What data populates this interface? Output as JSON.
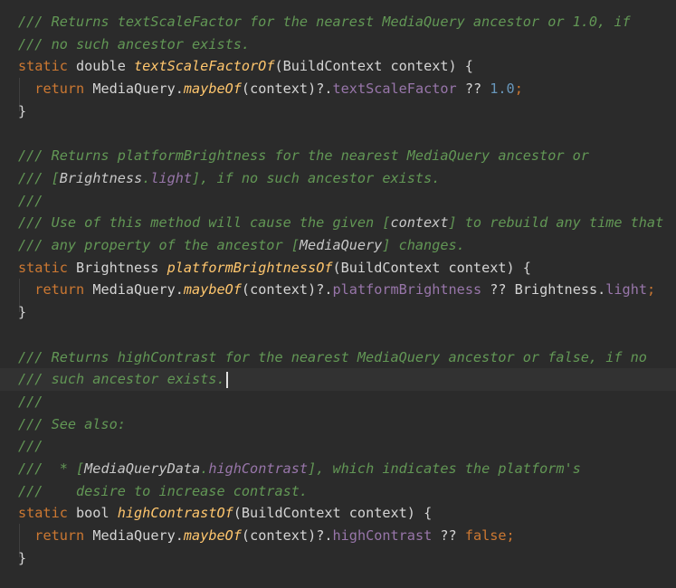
{
  "editor": {
    "language": "Dart",
    "colors": {
      "background": "#2b2b2b",
      "current_line": "#323232",
      "comment": "#629755",
      "keyword": "#cc7832",
      "function": "#ffc66d",
      "field": "#9876aa",
      "number": "#6897bb",
      "text": "#d4d4d4"
    },
    "lines": [
      [
        {
          "t": "comment",
          "v": "/// Returns textScaleFactor for the nearest MediaQuery ancestor or 1.0, if"
        }
      ],
      [
        {
          "t": "comment",
          "v": "/// no such ancestor exists."
        }
      ],
      [
        {
          "t": "keyword",
          "v": "static"
        },
        {
          "t": "plain",
          "v": " double "
        },
        {
          "t": "fn-decl",
          "v": "textScaleFactorOf"
        },
        {
          "t": "plain",
          "v": "(BuildContext context) {"
        }
      ],
      [
        {
          "t": "plain",
          "v": "  "
        },
        {
          "t": "keyword",
          "v": "return"
        },
        {
          "t": "plain",
          "v": " MediaQuery."
        },
        {
          "t": "fn-call",
          "v": "maybeOf"
        },
        {
          "t": "plain",
          "v": "(context)?."
        },
        {
          "t": "field",
          "v": "textScaleFactor"
        },
        {
          "t": "plain",
          "v": " ?? "
        },
        {
          "t": "number",
          "v": "1.0"
        },
        {
          "t": "keyword",
          "v": ";"
        }
      ],
      [
        {
          "t": "plain",
          "v": "}"
        }
      ],
      [],
      [
        {
          "t": "comment",
          "v": "/// Returns platformBrightness for the nearest MediaQuery ancestor or"
        }
      ],
      [
        {
          "t": "comment",
          "v": "/// ["
        },
        {
          "t": "doc-ref-text",
          "v": "Brightness"
        },
        {
          "t": "comment",
          "v": "."
        },
        {
          "t": "doc-ref-field",
          "v": "light"
        },
        {
          "t": "comment",
          "v": "], if no such ancestor exists."
        }
      ],
      [
        {
          "t": "comment",
          "v": "///"
        }
      ],
      [
        {
          "t": "comment",
          "v": "/// Use of this method will cause the given ["
        },
        {
          "t": "doc-ref-text",
          "v": "context"
        },
        {
          "t": "comment",
          "v": "] to rebuild any time that"
        }
      ],
      [
        {
          "t": "comment",
          "v": "/// any property of the ancestor ["
        },
        {
          "t": "doc-ref-text",
          "v": "MediaQuery"
        },
        {
          "t": "comment",
          "v": "] changes."
        }
      ],
      [
        {
          "t": "keyword",
          "v": "static"
        },
        {
          "t": "plain",
          "v": " Brightness "
        },
        {
          "t": "fn-decl",
          "v": "platformBrightnessOf"
        },
        {
          "t": "plain",
          "v": "(BuildContext context) {"
        }
      ],
      [
        {
          "t": "plain",
          "v": "  "
        },
        {
          "t": "keyword",
          "v": "return"
        },
        {
          "t": "plain",
          "v": " MediaQuery."
        },
        {
          "t": "fn-call",
          "v": "maybeOf"
        },
        {
          "t": "plain",
          "v": "(context)?."
        },
        {
          "t": "field",
          "v": "platformBrightness"
        },
        {
          "t": "plain",
          "v": " ?? Brightness."
        },
        {
          "t": "const",
          "v": "light"
        },
        {
          "t": "keyword",
          "v": ";"
        }
      ],
      [
        {
          "t": "plain",
          "v": "}"
        }
      ],
      [],
      [
        {
          "t": "comment",
          "v": "/// Returns highContrast for the nearest MediaQuery ancestor or false, if no"
        }
      ],
      [
        {
          "t": "comment",
          "v": "/// such ancestor exists."
        }
      ],
      [
        {
          "t": "comment",
          "v": "///"
        }
      ],
      [
        {
          "t": "comment",
          "v": "/// See also:"
        }
      ],
      [
        {
          "t": "comment",
          "v": "///"
        }
      ],
      [
        {
          "t": "comment",
          "v": "///  * ["
        },
        {
          "t": "doc-ref-text",
          "v": "MediaQueryData"
        },
        {
          "t": "comment",
          "v": "."
        },
        {
          "t": "doc-ref-field",
          "v": "highContrast"
        },
        {
          "t": "comment",
          "v": "], which indicates the platform's"
        }
      ],
      [
        {
          "t": "comment",
          "v": "///    desire to increase contrast."
        }
      ],
      [
        {
          "t": "keyword",
          "v": "static"
        },
        {
          "t": "plain",
          "v": " bool "
        },
        {
          "t": "fn-decl",
          "v": "highContrastOf"
        },
        {
          "t": "plain",
          "v": "(BuildContext context) {"
        }
      ],
      [
        {
          "t": "plain",
          "v": "  "
        },
        {
          "t": "keyword",
          "v": "return"
        },
        {
          "t": "plain",
          "v": " MediaQuery."
        },
        {
          "t": "fn-call",
          "v": "maybeOf"
        },
        {
          "t": "plain",
          "v": "(context)?."
        },
        {
          "t": "field",
          "v": "highContrast"
        },
        {
          "t": "plain",
          "v": " ?? "
        },
        {
          "t": "keyword",
          "v": "false;"
        }
      ],
      [
        {
          "t": "plain",
          "v": "}"
        }
      ]
    ],
    "current_line_index": 16
  }
}
